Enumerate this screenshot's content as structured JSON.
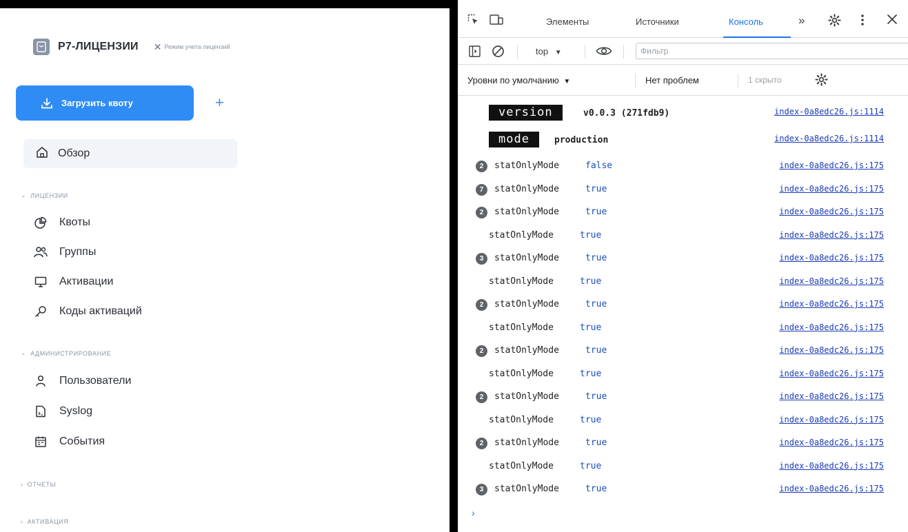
{
  "app": {
    "brand_name": "Р7-ЛИЦЕНЗИИ",
    "mode_close": "✕",
    "mode_label": "Режим учета лицензий",
    "upload_button": "Загрузить квоту",
    "add_button": "+",
    "overview": "Обзор",
    "sections": {
      "licenses": "ЛИЦЕНЗИИ",
      "admin": "АДМИНИСТРИРОВАНИЕ",
      "reports": "ОТЧЕТЫ",
      "activation": "АКТИВАЦИЯ"
    },
    "license_items": [
      "Квоты",
      "Группы",
      "Активации",
      "Коды активаций"
    ],
    "admin_items": [
      "Пользователи",
      "Syslog",
      "События"
    ]
  },
  "devtools": {
    "tabs": {
      "elements": "Элементы",
      "sources": "Источники",
      "console": "Консоль",
      "more": "»"
    },
    "context": "top",
    "filter_placeholder": "Фильтр",
    "levels": "Уровни по умолчанию",
    "issues": "Нет проблем",
    "hidden": "1 скрыто",
    "styled_logs": [
      {
        "key": "version",
        "value": "v0.0.3 (271fdb9)",
        "source": "index-0a8edc26.js:1114"
      },
      {
        "key": "mode",
        "value": "production",
        "source": "index-0a8edc26.js:1114"
      }
    ],
    "logs": [
      {
        "badge": "2",
        "key": "statOnlyMode",
        "value": "false",
        "source": "index-0a8edc26.js:175"
      },
      {
        "badge": "7",
        "key": "statOnlyMode",
        "value": "true",
        "source": "index-0a8edc26.js:175"
      },
      {
        "badge": "2",
        "key": "statOnlyMode",
        "value": "true",
        "source": "index-0a8edc26.js:175"
      },
      {
        "badge": "",
        "key": "statOnlyMode",
        "value": "true",
        "source": "index-0a8edc26.js:175"
      },
      {
        "badge": "3",
        "key": "statOnlyMode",
        "value": "true",
        "source": "index-0a8edc26.js:175"
      },
      {
        "badge": "",
        "key": "statOnlyMode",
        "value": "true",
        "source": "index-0a8edc26.js:175"
      },
      {
        "badge": "2",
        "key": "statOnlyMode",
        "value": "true",
        "source": "index-0a8edc26.js:175"
      },
      {
        "badge": "",
        "key": "statOnlyMode",
        "value": "true",
        "source": "index-0a8edc26.js:175"
      },
      {
        "badge": "2",
        "key": "statOnlyMode",
        "value": "true",
        "source": "index-0a8edc26.js:175"
      },
      {
        "badge": "",
        "key": "statOnlyMode",
        "value": "true",
        "source": "index-0a8edc26.js:175"
      },
      {
        "badge": "2",
        "key": "statOnlyMode",
        "value": "true",
        "source": "index-0a8edc26.js:175"
      },
      {
        "badge": "",
        "key": "statOnlyMode",
        "value": "true",
        "source": "index-0a8edc26.js:175"
      },
      {
        "badge": "2",
        "key": "statOnlyMode",
        "value": "true",
        "source": "index-0a8edc26.js:175"
      },
      {
        "badge": "",
        "key": "statOnlyMode",
        "value": "true",
        "source": "index-0a8edc26.js:175"
      },
      {
        "badge": "3",
        "key": "statOnlyMode",
        "value": "true",
        "source": "index-0a8edc26.js:175"
      }
    ],
    "prompt": "›"
  }
}
